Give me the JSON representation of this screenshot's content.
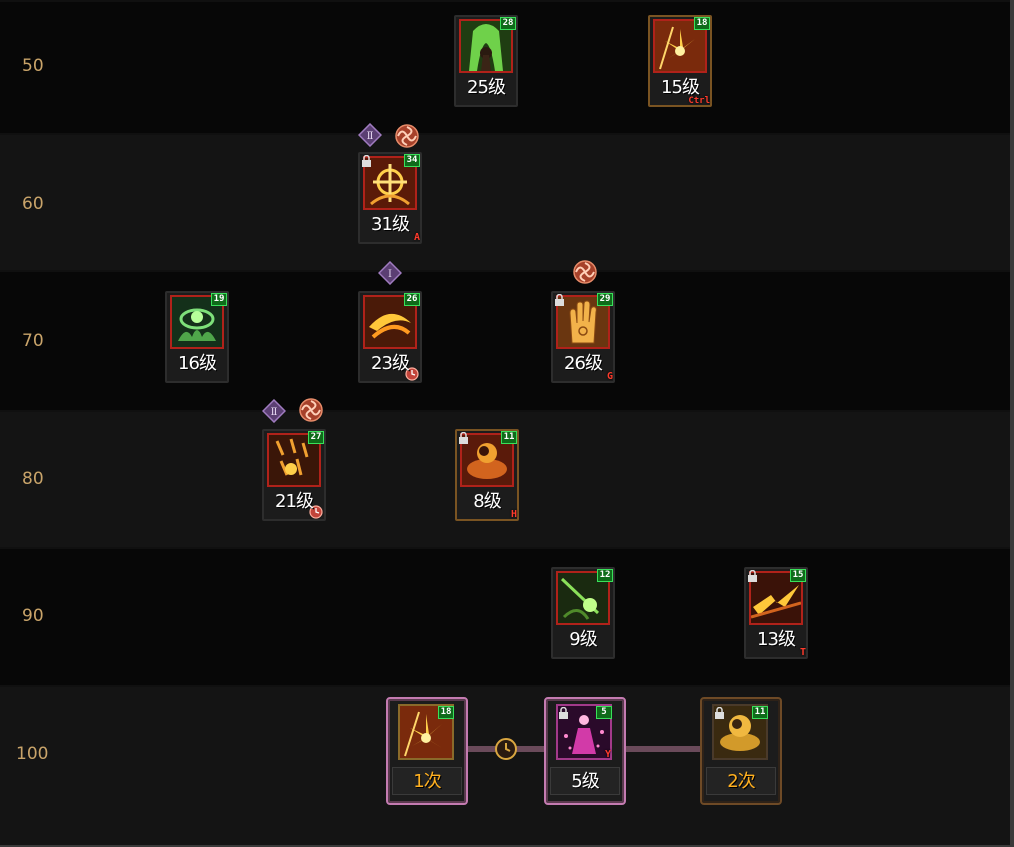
{
  "level_rows": [
    {
      "level": "50"
    },
    {
      "level": "60"
    },
    {
      "level": "70"
    },
    {
      "level": "80"
    },
    {
      "level": "90"
    },
    {
      "level": "100"
    }
  ],
  "skills": {
    "s50a": {
      "badge": "28",
      "label": "25级",
      "icon": "green-spirit-arch-icon",
      "locked": false,
      "hotkey": ""
    },
    "s50b": {
      "badge": "18",
      "label": "15级",
      "icon": "golden-flower-burst-icon",
      "locked": false,
      "hotkey": "Ctrl"
    },
    "s60a": {
      "badge": "34",
      "label": "31级",
      "icon": "golden-cross-bloom-icon",
      "locked": true,
      "hotkey": "A",
      "tier": "Ⅱ",
      "has_swirl": true
    },
    "s70a": {
      "badge": "19",
      "label": "16级",
      "icon": "green-lotus-icon",
      "locked": false,
      "hotkey": ""
    },
    "s70b": {
      "badge": "26",
      "label": "23级",
      "icon": "golden-whirl-icon",
      "locked": false,
      "hotkey": "",
      "tier": "Ⅰ",
      "has_alarm": true
    },
    "s70c": {
      "badge": "29",
      "label": "26级",
      "icon": "golden-palm-icon",
      "locked": true,
      "hotkey": "G",
      "has_swirl": true
    },
    "s80a": {
      "badge": "27",
      "label": "21级",
      "icon": "ember-rain-icon",
      "locked": false,
      "hotkey": "",
      "tier": "Ⅱ",
      "has_swirl": true,
      "has_alarm": true
    },
    "s80b": {
      "badge": "11",
      "label": "8级",
      "icon": "crimson-vortex-icon",
      "locked": true,
      "hotkey": "H"
    },
    "s90a": {
      "badge": "12",
      "label": "9级",
      "icon": "green-spear-icon",
      "locked": false,
      "hotkey": ""
    },
    "s90b": {
      "badge": "15",
      "label": "13级",
      "icon": "golden-shockwave-icon",
      "locked": true,
      "hotkey": "T"
    }
  },
  "awakening": {
    "left": {
      "badge": "18",
      "label": "1次",
      "icon": "golden-flower-burst-icon"
    },
    "center": {
      "badge": "5",
      "label": "5级",
      "icon": "pink-dancer-icon",
      "locked": true,
      "hotkey": "Y"
    },
    "right": {
      "badge": "11",
      "label": "2次",
      "icon": "golden-vortex-icon",
      "locked": true
    },
    "connector_icon": "clock-icon"
  },
  "colors": {
    "level_text": "#c9a46a",
    "badge_green": "#0f6b1a",
    "icon_border_red": "#b0221a",
    "hotkey_red": "#ff3b2c",
    "awakening_count_yellow": "#ffb020",
    "awakening_pink": "#c47bb1"
  }
}
